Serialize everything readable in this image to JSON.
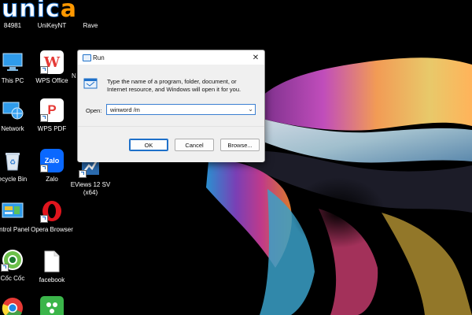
{
  "watermark": {
    "text_main": "unic",
    "text_accent": "a"
  },
  "desktop_icons": [
    {
      "label": "84981"
    },
    {
      "label": "UniKeyNT"
    },
    {
      "label": "Rave"
    },
    {
      "label": "This PC"
    },
    {
      "label": "WPS Office"
    },
    {
      "label": "N"
    },
    {
      "label": "Network"
    },
    {
      "label": "WPS PDF"
    },
    {
      "label": "ecycle Bin"
    },
    {
      "label": "Zalo"
    },
    {
      "label": "EViews 12 SV (x64)"
    },
    {
      "label": "ontrol Panel"
    },
    {
      "label": "Opera Browser"
    },
    {
      "label": "Cốc Cốc"
    },
    {
      "label": "facebook"
    }
  ],
  "run_dialog": {
    "title": "Run",
    "description": "Type the name of a program, folder, document, or Internet resource, and Windows will open it for you.",
    "open_label": "Open:",
    "open_value": "winword /m",
    "ok_label": "OK",
    "cancel_label": "Cancel",
    "browse_label": "Browse..."
  },
  "colors": {
    "accent": "#1e70c9",
    "desktop_bg": "#000000",
    "dialog_bg": "#f0f0f0"
  }
}
